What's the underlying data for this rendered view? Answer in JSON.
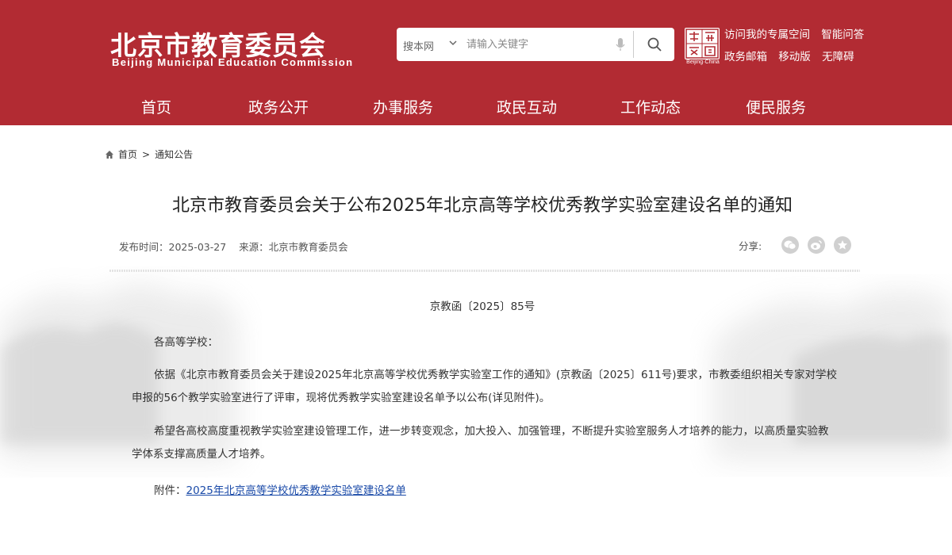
{
  "header": {
    "logo_cn": "北京市教育委员会",
    "logo_en": "Beijing Municipal Education Commission",
    "seal_text": "Beijing·China",
    "search": {
      "scope": "搜本网",
      "placeholder": "请输入关键字"
    },
    "top_links": {
      "row1": [
        "访问我的专属空间",
        "智能问答"
      ],
      "row2": [
        "政务邮箱",
        "移动版",
        "无障碍"
      ]
    }
  },
  "nav": [
    "首页",
    "政务公开",
    "办事服务",
    "政民互动",
    "工作动态",
    "便民服务"
  ],
  "breadcrumb": {
    "home": "首页",
    "sep": ">",
    "current": "通知公告"
  },
  "article": {
    "title": "北京市教育委员会关于公布2025年北京高等学校优秀教学实验室建设名单的通知",
    "publish_time": "发布时间：2025-03-27",
    "source": "来源：北京市教育委员会",
    "share_label": "分享:",
    "doc_number": "京教函〔2025〕85号",
    "salutation": "各高等学校：",
    "paragraphs": [
      "依据《北京市教育委员会关于建设2025年北京高等学校优秀教学实验室工作的通知》(京教函〔2025〕611号)要求，市教委组织相关专家对学校申报的56个教学实验室进行了评审，现将优秀教学实验室建设名单予以公布(详见附件)。",
      "希望各高校高度重视教学实验室建设管理工作，进一步转变观念，加大投入、加强管理，不断提升实验室服务人才培养的能力，以高质量实验教学体系支撑高质量人才培养。"
    ],
    "attachment_label": "附件：",
    "attachment_link": "2025年北京高等学校优秀教学实验室建设名单"
  },
  "colors": {
    "brand_red": "#b22b33",
    "link_blue": "#1a4aa8"
  }
}
